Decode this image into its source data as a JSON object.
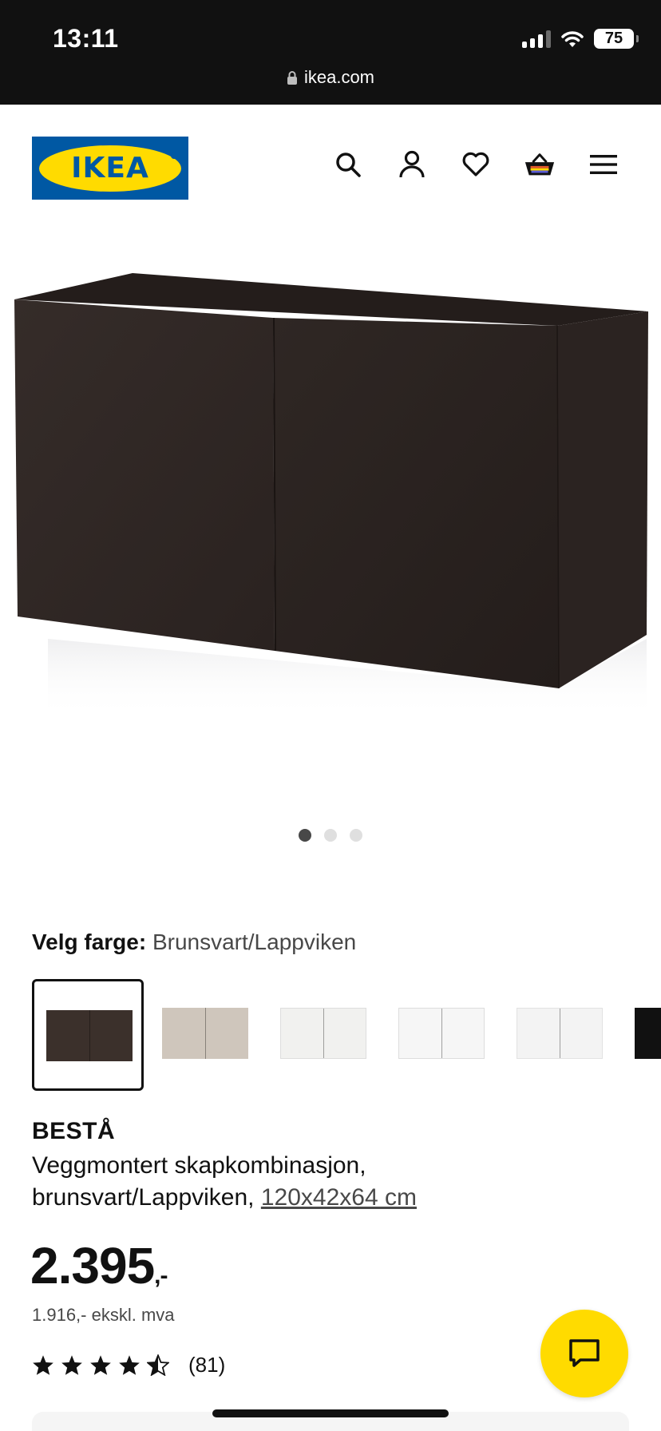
{
  "status_bar": {
    "time": "13:11",
    "battery": "75"
  },
  "browser": {
    "url": "ikea.com"
  },
  "header": {
    "logo_text": "IKEA",
    "icons": [
      "search-icon",
      "account-icon",
      "heart-icon",
      "basket-icon",
      "menu-icon"
    ]
  },
  "gallery": {
    "slide_count": 3,
    "active_slide": 1
  },
  "color_selector": {
    "label": "Velg farge:",
    "value": "Brunsvart/Lappviken",
    "swatches": [
      {
        "color": "#3b302b",
        "selected": true
      },
      {
        "color": "#cfc6bc",
        "selected": false
      },
      {
        "color": "#f1f1ef",
        "selected": false
      },
      {
        "color": "#f6f6f6",
        "selected": false
      },
      {
        "color": "#f3f3f3",
        "selected": false
      },
      {
        "color": "#111111",
        "selected": false
      }
    ]
  },
  "product": {
    "name": "BESTÅ",
    "description_line1": "Veggmontert skapkombinasjon,",
    "description_line2": "brunsvart/Lappviken,",
    "size": "120x42x64 cm"
  },
  "price": {
    "amount": "2.395",
    "suffix": ",-",
    "excl_vat": "1.916,- ekskl. mva"
  },
  "rating": {
    "stars": 4.5,
    "count": "(81)"
  },
  "colors": {
    "ikea_blue": "#0058a3",
    "ikea_yellow": "#ffdb00",
    "cabinet": "#2f2724"
  }
}
